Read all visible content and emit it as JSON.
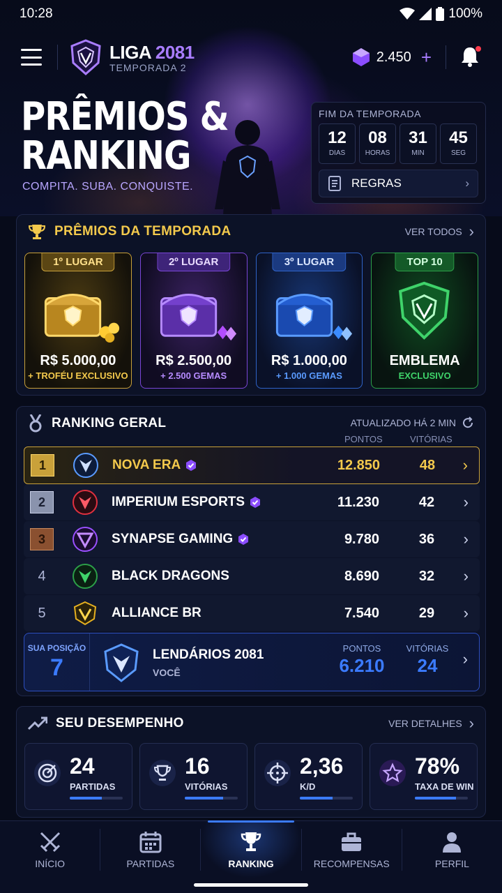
{
  "status": {
    "time": "10:28",
    "battery": "100%"
  },
  "header": {
    "brand_main": "LIGA",
    "brand_year": "2081",
    "brand_sub": "TEMPORADA 2",
    "gems": "2.450",
    "gem_plus": "+"
  },
  "hero": {
    "title_line1": "PRÊMIOS &",
    "title_line2": "RANKING",
    "subtitle": "COMPITA. SUBA. CONQUISTE."
  },
  "season": {
    "label": "FIM DA TEMPORADA",
    "timer": [
      {
        "value": "12",
        "unit": "DIAS"
      },
      {
        "value": "08",
        "unit": "HORAS"
      },
      {
        "value": "31",
        "unit": "MIN"
      },
      {
        "value": "45",
        "unit": "SEG"
      }
    ],
    "rules_label": "REGRAS"
  },
  "prizes": {
    "title": "PRÊMIOS DA TEMPORADA",
    "see_all": "VER TODOS",
    "items": [
      {
        "tag": "1º LUGAR",
        "amount": "R$ 5.000,00",
        "extra": "+ TROFÉU EXCLUSIVO",
        "color": "#c9a13a"
      },
      {
        "tag": "2º LUGAR",
        "amount": "R$ 2.500,00",
        "extra": "+ 2.500 GEMAS",
        "color": "#7a46d6"
      },
      {
        "tag": "3º LUGAR",
        "amount": "R$ 1.000,00",
        "extra": "+ 1.000 GEMAS",
        "color": "#2f63c9"
      },
      {
        "tag": "TOP 10",
        "amount": "EMBLEMA",
        "extra": "EXCLUSIVO",
        "color": "#2c9f48"
      }
    ]
  },
  "ranking": {
    "title": "RANKING GERAL",
    "updated": "ATUALIZADO HÁ 2 MIN",
    "col_points": "PONTOS",
    "col_wins": "VITÓRIAS",
    "rows": [
      {
        "pos": "1",
        "team": "NOVA ERA",
        "points": "12.850",
        "wins": "48",
        "verified": true
      },
      {
        "pos": "2",
        "team": "IMPERIUM ESPORTS",
        "points": "11.230",
        "wins": "42",
        "verified": true
      },
      {
        "pos": "3",
        "team": "SYNAPSE GAMING",
        "points": "9.780",
        "wins": "36",
        "verified": true
      },
      {
        "pos": "4",
        "team": "BLACK DRAGONS",
        "points": "8.690",
        "wins": "32",
        "verified": false
      },
      {
        "pos": "5",
        "team": "ALLIANCE BR",
        "points": "7.540",
        "wins": "29",
        "verified": false
      }
    ],
    "you": {
      "label": "SUA POSIÇÃO",
      "pos": "7",
      "team": "LENDÁRIOS 2081",
      "sub": "VOCÊ",
      "points_label": "PONTOS",
      "points": "6.210",
      "wins_label": "VITÓRIAS",
      "wins": "24"
    }
  },
  "performance": {
    "title": "SEU DESEMPENHO",
    "details": "VER DETALHES",
    "stats": [
      {
        "value": "24",
        "label": "PARTIDAS",
        "icon": "target-icon",
        "progress": 0.6
      },
      {
        "value": "16",
        "label": "VITÓRIAS",
        "icon": "trophy-icon",
        "progress": 0.72
      },
      {
        "value": "2,36",
        "label": "K/D",
        "icon": "crosshair-icon",
        "progress": 0.62
      },
      {
        "value": "78%",
        "label": "TAXA DE WIN",
        "icon": "star-icon",
        "progress": 0.78
      }
    ]
  },
  "nav": {
    "items": [
      {
        "label": "INÍCIO",
        "icon": "crossed-swords-icon"
      },
      {
        "label": "PARTIDAS",
        "icon": "calendar-icon"
      },
      {
        "label": "RANKING",
        "icon": "trophy-icon",
        "active": true
      },
      {
        "label": "RECOMPENSAS",
        "icon": "briefcase-icon"
      },
      {
        "label": "PERFIL",
        "icon": "user-icon"
      }
    ]
  }
}
